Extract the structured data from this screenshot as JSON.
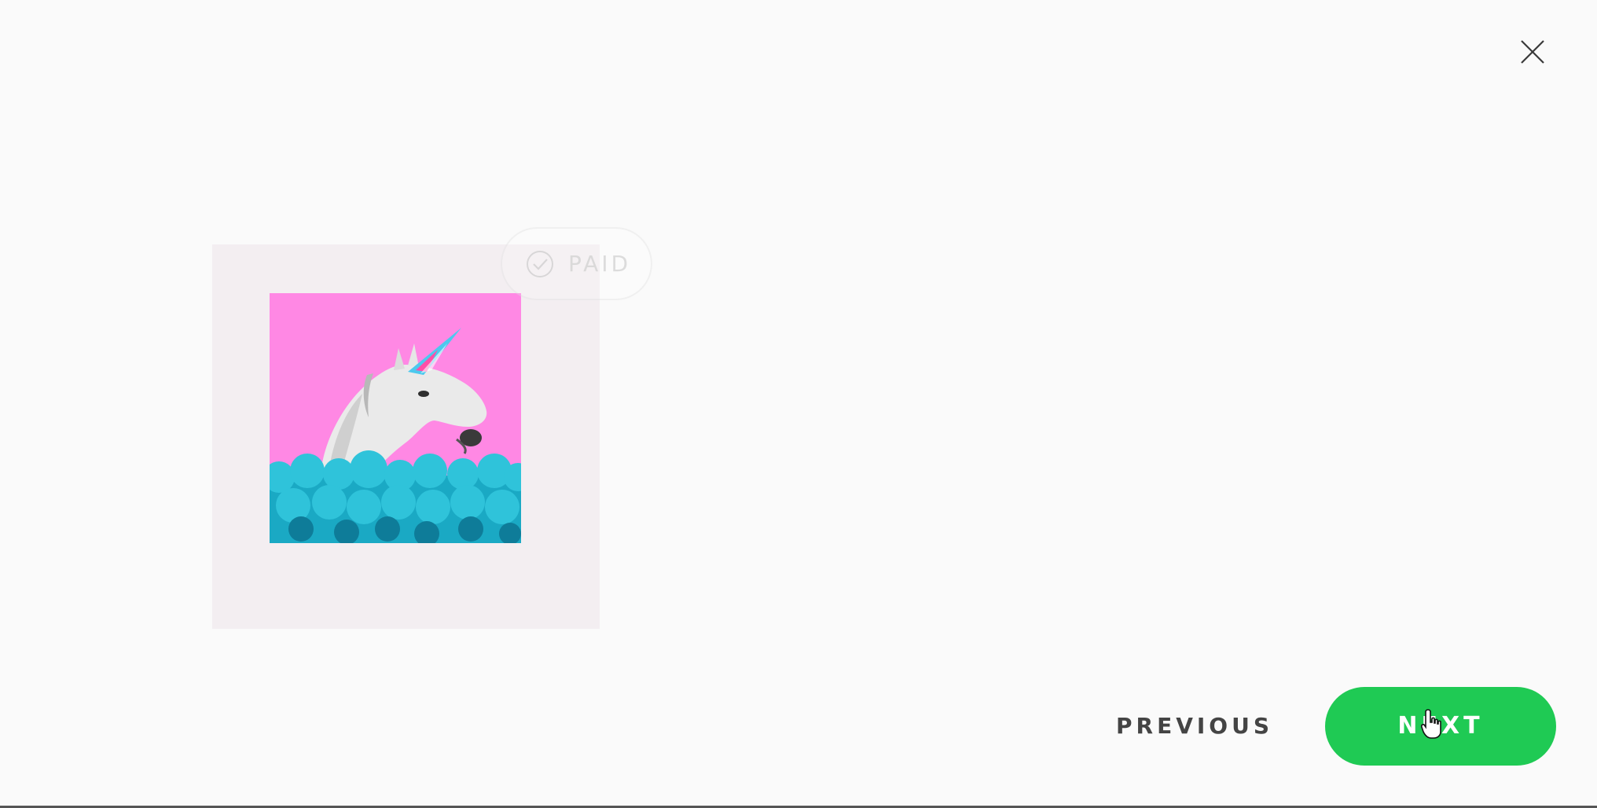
{
  "dialog": {
    "close_label": "Close"
  },
  "artwork": {
    "subject": "unicode-unicorn-artwork",
    "background_color": "#ff88e4",
    "card_color": "#f3eef1"
  },
  "badge": {
    "label": "PAID",
    "icon": "check-circle-icon"
  },
  "navigation": {
    "previous_label": "PREVIOUS",
    "next_label": "NEXT",
    "accent_color": "#1fca54"
  },
  "cursor": {
    "icon": "hand-pointer-icon"
  }
}
